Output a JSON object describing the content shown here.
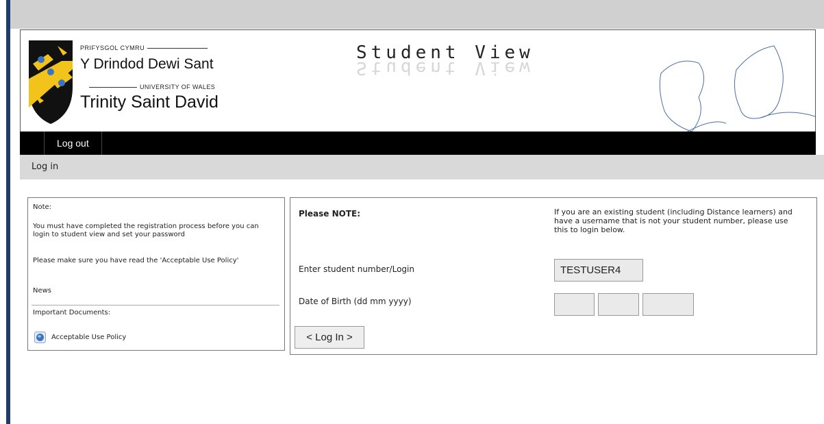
{
  "header": {
    "uni_small": "PRIFYSGOL CYMRU",
    "uni_welsh": "Y Drindod Dewi Sant",
    "uni_wales": "UNIVERSITY OF WALES",
    "uni_english": "Trinity Saint David",
    "title": "Student View"
  },
  "nav": {
    "logout_label": "Log out"
  },
  "breadcrumb": "Log in",
  "note_panel": {
    "heading": "Note:",
    "registration_note": "You must have completed the registration process before you can login to student view and set your password",
    "policy_note": "Please make sure you have read the 'Acceptable Use Policy'",
    "news_label": "News",
    "documents_label": "Important Documents:",
    "policy_link": "Acceptable Use Policy"
  },
  "login_panel": {
    "note_heading": "Please NOTE:",
    "info": "If you are an existing student (including Distance learners) and have a username that is not your student number, please use this to login below.",
    "student_label": "Enter student number/Login",
    "student_value": "TESTUSER4",
    "dob_label": "Date of Birth (dd mm yyyy)",
    "dob_day": "",
    "dob_month": "",
    "dob_year": "",
    "login_button": "< Log In >"
  },
  "colors": {
    "left_rule": "#1f3c6e",
    "nav_bg": "#000000",
    "band_gray": "#d0d0d0",
    "crest_yellow": "#f2c31b",
    "crest_blue": "#3c74c4"
  }
}
